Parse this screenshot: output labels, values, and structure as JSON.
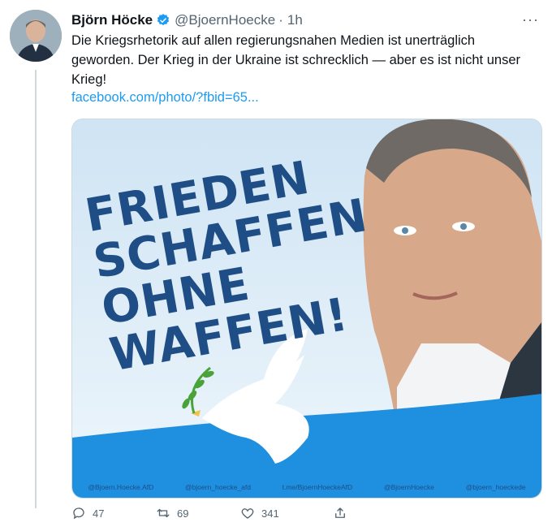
{
  "tweet": {
    "author_name": "Björn Höcke",
    "handle": "@BjoernHoecke",
    "separator": "·",
    "time": "1h",
    "more": "···",
    "text": "Die Kriegsrhetorik auf allen regierungsnahen Medien ist unerträglich geworden. Der Krieg in der Ukraine ist schrecklich — aber es ist nicht unser Krieg!",
    "link": "facebook.com/photo/?fbid=65..."
  },
  "card": {
    "slogan": [
      "FRIEDEN",
      "SCHAFFEN",
      "OHNE",
      "WAFFEN!"
    ],
    "footer": [
      "@Bjoern.Hoecke.AfD",
      "@bjoern_hoecke_afd",
      "t.me/BjoernHoeckeAfD",
      "@BjoernHoecke",
      "@bjoern_hoeckede"
    ],
    "colors": {
      "slogan": "#1f4e86",
      "background": "#dfeef8",
      "wave": "#1f8fe0"
    }
  },
  "actions": {
    "reply_count": "47",
    "retweet_count": "69",
    "like_count": "341"
  }
}
